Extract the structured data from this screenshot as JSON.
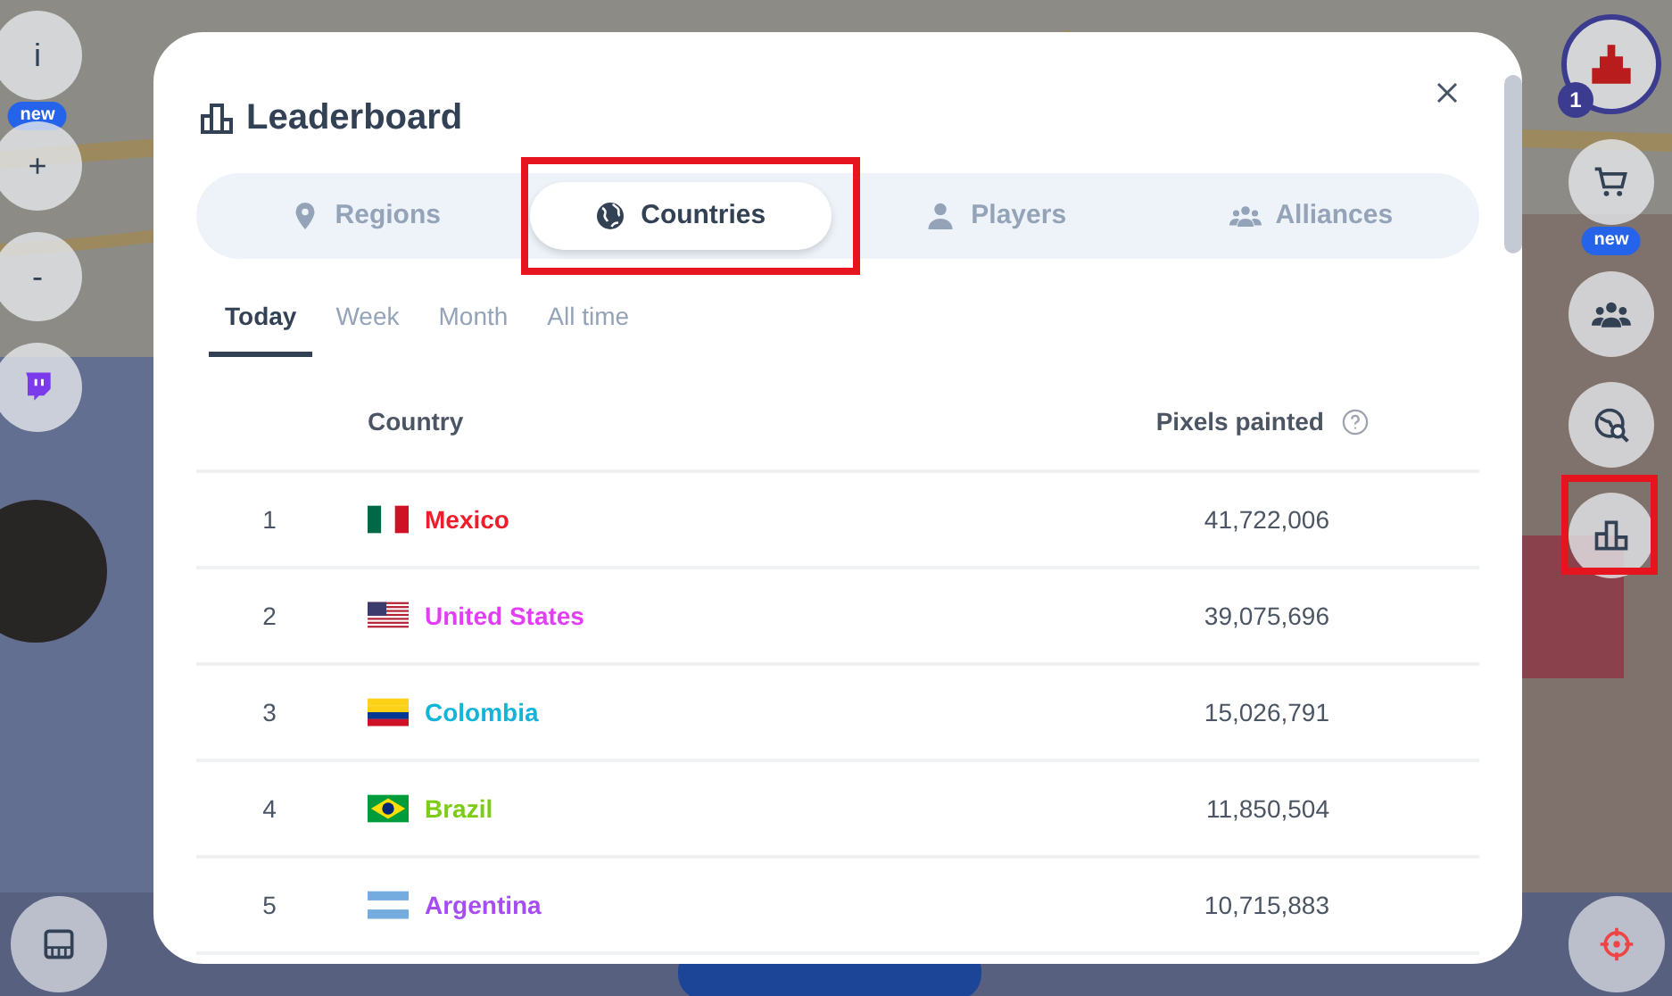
{
  "left_controls": [
    {
      "kind": "info",
      "label": "i",
      "badge": "new"
    },
    {
      "kind": "zoom",
      "label": "+"
    },
    {
      "kind": "zoom",
      "label": "-"
    },
    {
      "kind": "twitch"
    }
  ],
  "right_controls": [
    {
      "kind": "avatar",
      "badge": "1"
    },
    {
      "kind": "cart",
      "badge": "new"
    },
    {
      "kind": "group"
    },
    {
      "kind": "search"
    },
    {
      "kind": "leaderboard",
      "highlighted": true
    }
  ],
  "modal": {
    "title": "Leaderboard",
    "tabs": [
      {
        "label": "Regions",
        "selected": false,
        "highlighted": false
      },
      {
        "label": "Countries",
        "selected": true,
        "highlighted": true
      },
      {
        "label": "Players",
        "selected": false,
        "highlighted": false
      },
      {
        "label": "Alliances",
        "selected": false,
        "highlighted": false
      }
    ],
    "periods": [
      {
        "label": "Today",
        "selected": true
      },
      {
        "label": "Week",
        "selected": false
      },
      {
        "label": "Month",
        "selected": false
      },
      {
        "label": "All time",
        "selected": false
      }
    ],
    "table": {
      "columns": [
        "Country",
        "Pixels painted"
      ],
      "rows": [
        {
          "rank": "1",
          "country": "Mexico",
          "color": "#ef1c2a",
          "pixels": "41,722,006"
        },
        {
          "rank": "2",
          "country": "United States",
          "color": "#e23ef5",
          "pixels": "39,075,696"
        },
        {
          "rank": "3",
          "country": "Colombia",
          "color": "#14b4d8",
          "pixels": "15,026,791"
        },
        {
          "rank": "4",
          "country": "Brazil",
          "color": "#7ccc16",
          "pixels": "11,850,504"
        },
        {
          "rank": "5",
          "country": "Argentina",
          "color": "#a64cf5",
          "pixels": "10,715,883"
        }
      ]
    }
  },
  "bottom_controls": [
    {
      "kind": "palette"
    },
    {
      "kind": "target"
    }
  ]
}
